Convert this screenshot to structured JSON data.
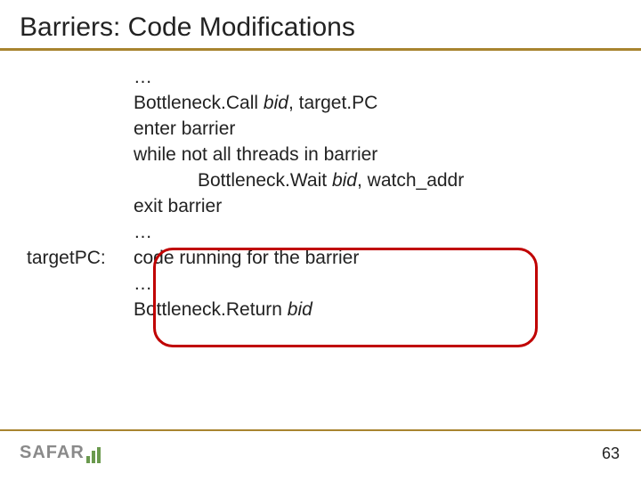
{
  "slide": {
    "title": "Barriers: Code Modifications",
    "label": "targetPC:",
    "lines": {
      "l0": "…",
      "l1a": "Bottleneck.Call ",
      "l1b": "bid",
      "l1c": ", target.PC",
      "l2": "enter barrier",
      "l3": "while not all threads in barrier",
      "l4a": "Bottleneck.Wait ",
      "l4b": "bid",
      "l4c": ", watch_addr",
      "l5": "exit barrier",
      "l6": "…",
      "l7": "code running for the barrier",
      "l8": "…",
      "l9a": "Bottleneck.Return ",
      "l9b": "bid"
    },
    "footer_brand": "SAFAR",
    "page_number": "63"
  }
}
